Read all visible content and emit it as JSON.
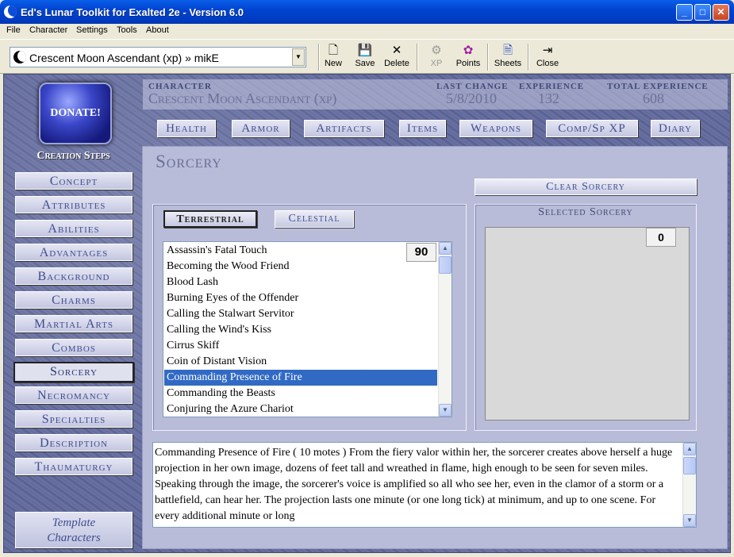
{
  "window": {
    "title": "Ed's Lunar Toolkit for Exalted 2e - Version 6.0",
    "minimize": "_",
    "maximize": "□",
    "close": "✕"
  },
  "menu": [
    "File",
    "Character",
    "Settings",
    "Tools",
    "About"
  ],
  "toolbar": {
    "character_combo": "Crescent Moon Ascendant (xp) » mikE",
    "combo_arrow": "▼",
    "buttons": [
      {
        "label": "New",
        "icon": "new-file-icon",
        "glyph": "🗋"
      },
      {
        "label": "Save",
        "icon": "floppy-disk-icon",
        "glyph": "💾"
      },
      {
        "label": "Delete",
        "icon": "delete-x-icon",
        "glyph": "✕"
      },
      {
        "label": "XP",
        "icon": "xp-icon",
        "glyph": "⚙"
      },
      {
        "label": "Points",
        "icon": "palette-icon",
        "glyph": "✿"
      },
      {
        "label": "Sheets",
        "icon": "sheets-icon",
        "glyph": "🗎"
      },
      {
        "label": "Close",
        "icon": "exit-door-icon",
        "glyph": "⇥"
      }
    ]
  },
  "donate": {
    "label": "DONATE!"
  },
  "creation": {
    "title": "Creation Steps",
    "steps": [
      "Concept",
      "Attributes",
      "Abilities",
      "Advantages",
      "Background",
      "Charms",
      "Martial Arts",
      "Combos",
      "Sorcery",
      "Necromancy",
      "Specialties",
      "Description",
      "Thaumaturgy"
    ],
    "active": "Sorcery",
    "template_line1": "Template",
    "template_line2": "Characters"
  },
  "header": {
    "character_label": "CHARACTER",
    "character_value": "Crescent Moon Ascendant (xp)",
    "last_change_label": "LAST CHANGE",
    "last_change_value": "5/8/2010",
    "experience_label": "EXPERIENCE",
    "experience_value": "132",
    "total_experience_label": "TOTAL EXPERIENCE",
    "total_experience_value": "608"
  },
  "nav": [
    "Health",
    "Armor",
    "Artifacts",
    "Items",
    "Weapons",
    "Comp/Sp XP",
    "Diary"
  ],
  "sorcery": {
    "title": "Sorcery",
    "clear_label": "Clear Sorcery",
    "tabs": [
      "Terrestrial",
      "Celestial"
    ],
    "active_tab": "Terrestrial",
    "list_count": "90",
    "spells": [
      "Assassin's Fatal Touch",
      "Becoming the Wood Friend",
      "Blood Lash",
      "Burning Eyes of the Offender",
      "Calling the Stalwart Servitor",
      "Calling the Wind's Kiss",
      "Cirrus Skiff",
      "Coin of Distant Vision",
      "Commanding Presence of Fire",
      "Commanding the Beasts",
      "Conjuring the Azure Chariot"
    ],
    "selected_index": 8,
    "selected_title": "Selected Sorcery",
    "selected_count": "0",
    "description": "Commanding Presence of Fire ( 10 motes ) From the fiery valor within her, the sorcerer creates above herself a huge projection in her own image, dozens of feet tall and wreathed in flame, high enough to be seen for seven miles.  Speaking through the image, the sorcerer's voice is amplified so all who see her, even in the clamor of a storm or a battlefield, can hear her. The projection lasts one minute (or one long tick) at minimum, and up to one scene. For every additional minute or long"
  },
  "scroll_up": "▲",
  "scroll_down": "▼"
}
